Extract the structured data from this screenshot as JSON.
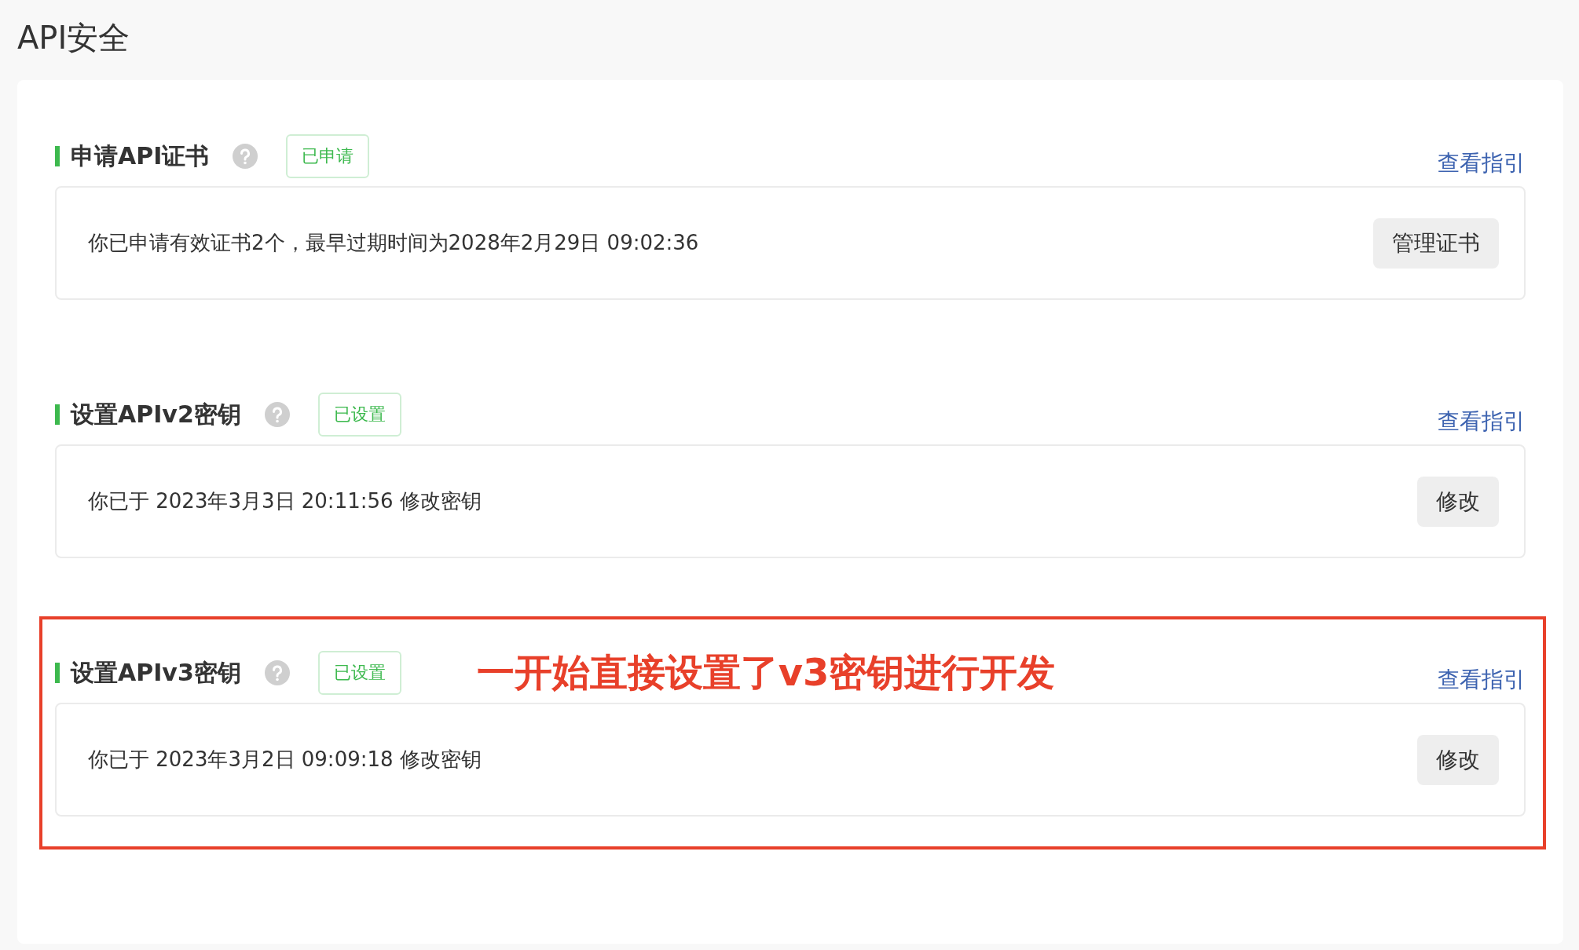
{
  "page": {
    "title": "API安全"
  },
  "sections": [
    {
      "title": "申请API证书",
      "status": "已申请",
      "guide_link": "查看指引",
      "message": "你已申请有效证书2个，最早过期时间为2028年2月29日 09:02:36",
      "button": "管理证书",
      "highlighted": false
    },
    {
      "title": "设置APIv2密钥",
      "status": "已设置",
      "guide_link": "查看指引",
      "message": "你已于 2023年3月3日 20:11:56 修改密钥",
      "button": "修改",
      "highlighted": false
    },
    {
      "title": "设置APIv3密钥",
      "status": "已设置",
      "guide_link": "查看指引",
      "message": "你已于 2023年3月2日 09:09:18 修改密钥",
      "button": "修改",
      "highlighted": true,
      "annotation": "一开始直接设置了v3密钥进行开发"
    }
  ]
}
